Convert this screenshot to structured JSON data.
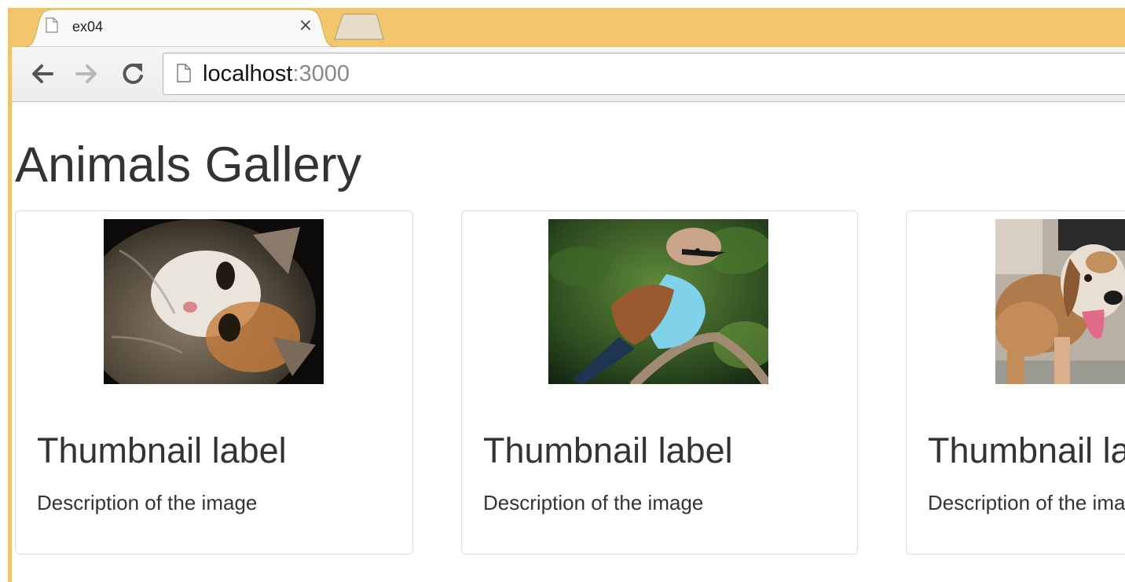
{
  "browser": {
    "tab": {
      "title": "ex04",
      "close_glyph": "×",
      "icon": "page-icon"
    },
    "nav": {
      "back_icon": "arrow-left-icon",
      "forward_icon": "arrow-right-icon",
      "reload_icon": "reload-icon"
    },
    "address_bar": {
      "host": "localhost",
      "port": ":3000"
    },
    "colors": {
      "tab_strip": "#f2c66d",
      "frame": "#efc46c"
    }
  },
  "page": {
    "title": "Animals Gallery",
    "cards": [
      {
        "image": "cat-photo",
        "label": "Thumbnail label",
        "description": "Description of the image"
      },
      {
        "image": "bird-photo",
        "label": "Thumbnail label",
        "description": "Description of the image"
      },
      {
        "image": "dog-photo",
        "label": "Thumbnail label",
        "description": "Description of the image"
      }
    ]
  }
}
